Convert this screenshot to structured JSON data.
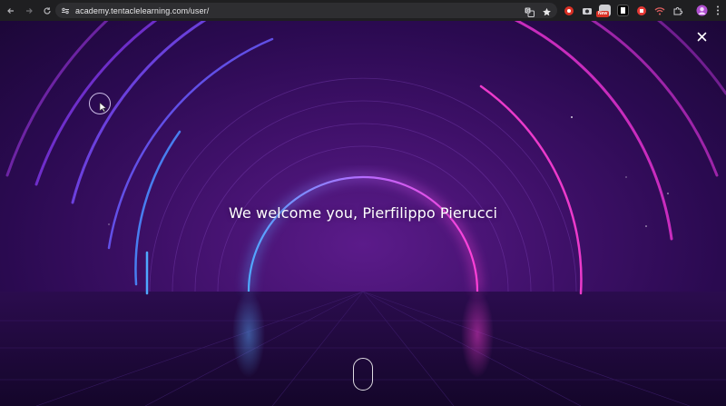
{
  "browser": {
    "url": "academy.tentaclelearning.com/user/",
    "extension_badge": "New",
    "icons": [
      "back-icon",
      "forward-icon",
      "reload-icon",
      "site-info-icon",
      "translate-icon",
      "bookmark-star-icon",
      "extensions-puzzle-icon",
      "profile-avatar",
      "kebab-menu-icon"
    ]
  },
  "page": {
    "welcome_text": "We welcome you, Pierfilippo Pierucci",
    "close_icon": "close-icon",
    "scroll_icon": "scroll-indicator-icon"
  },
  "colors": {
    "arch_blue": "#4fa8ff",
    "arch_pink": "#ff3fd6",
    "background_purple": "#3e1068"
  }
}
